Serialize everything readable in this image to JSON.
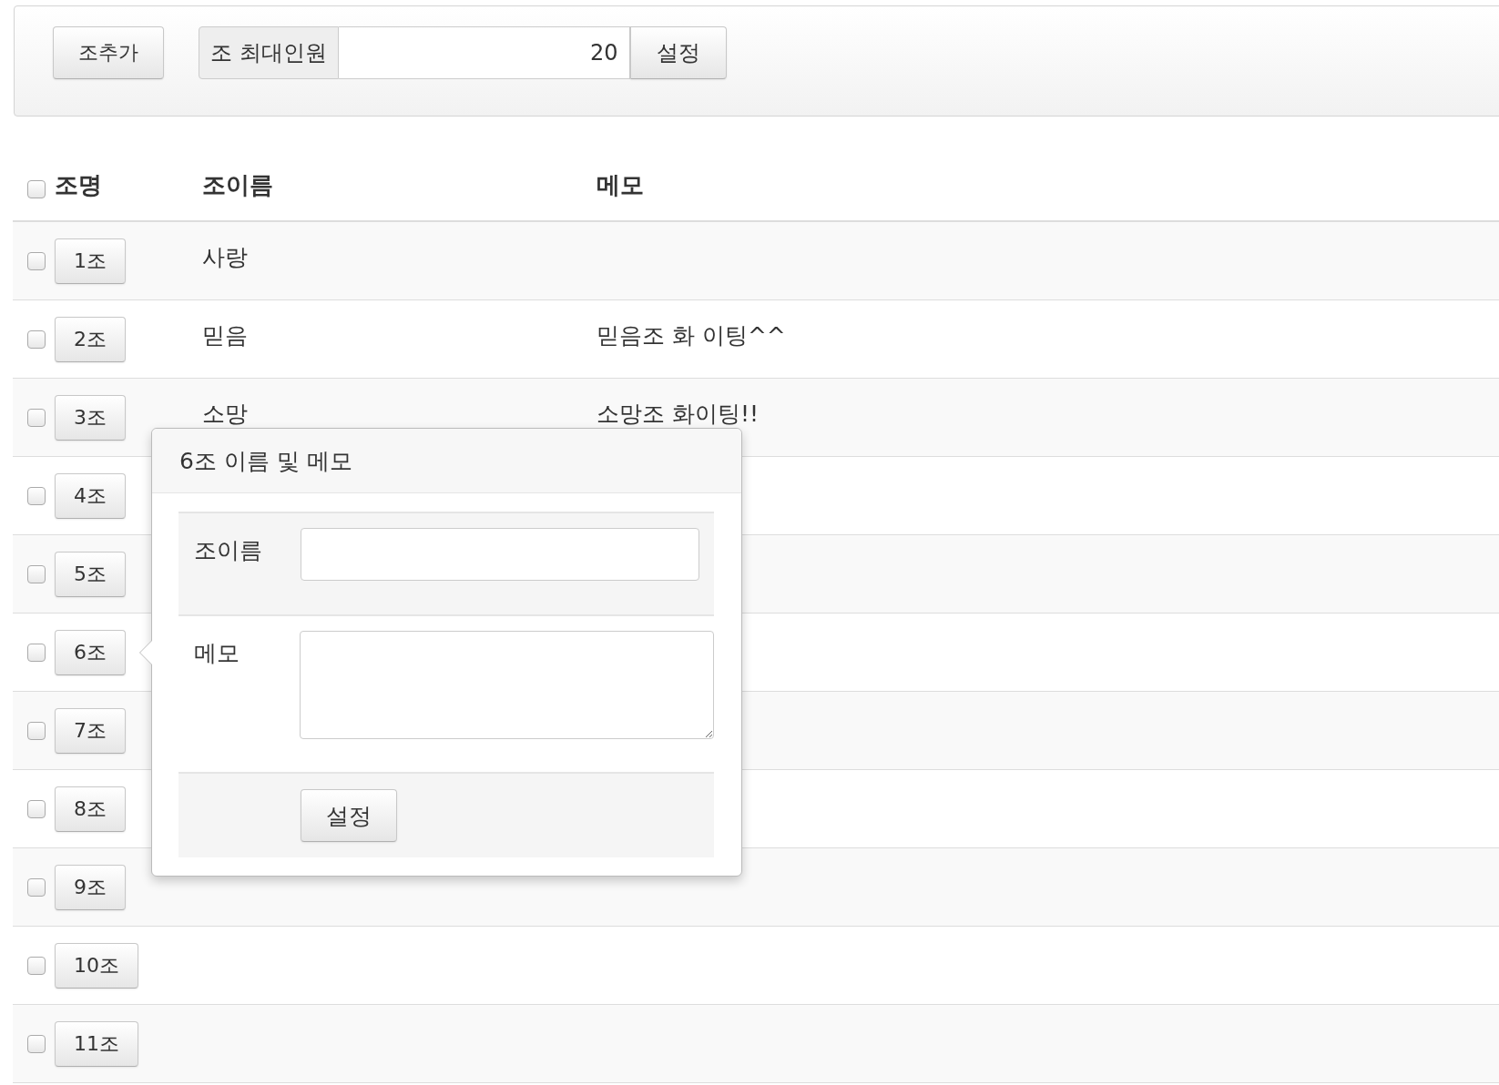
{
  "toolbar": {
    "add_button": "조추가",
    "max_label": "조 최대인원",
    "max_value": "20",
    "set_button": "설정"
  },
  "table": {
    "select_all_checked": false,
    "columns": [
      "조명",
      "조이름",
      "메모"
    ],
    "rows": [
      {
        "checked": false,
        "group": "1조",
        "name": "사랑",
        "memo": ""
      },
      {
        "checked": false,
        "group": "2조",
        "name": "믿음",
        "memo": "믿음조 화 이팅^^"
      },
      {
        "checked": false,
        "group": "3조",
        "name": "소망",
        "memo": "소망조 화이팅!!"
      },
      {
        "checked": false,
        "group": "4조",
        "name": "",
        "memo": ""
      },
      {
        "checked": false,
        "group": "5조",
        "name": "",
        "memo": ""
      },
      {
        "checked": false,
        "group": "6조",
        "name": "",
        "memo": ""
      },
      {
        "checked": false,
        "group": "7조",
        "name": "",
        "memo": ""
      },
      {
        "checked": false,
        "group": "8조",
        "name": "",
        "memo": ""
      },
      {
        "checked": false,
        "group": "9조",
        "name": "",
        "memo": ""
      },
      {
        "checked": false,
        "group": "10조",
        "name": "",
        "memo": ""
      },
      {
        "checked": false,
        "group": "11조",
        "name": "",
        "memo": ""
      }
    ]
  },
  "popover": {
    "title": "6조 이름 및 메모",
    "fields": [
      {
        "kind": "input",
        "label": "조이름"
      },
      {
        "kind": "textarea",
        "label": "메모"
      }
    ],
    "button": "설정"
  }
}
